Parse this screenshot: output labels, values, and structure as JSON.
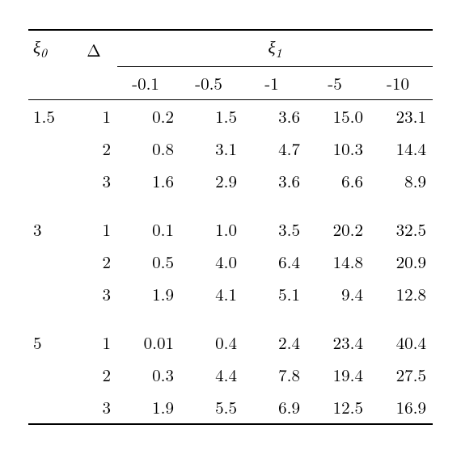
{
  "headers": {
    "xi0": "ξ",
    "xi0_sub": "0",
    "delta": "Δ",
    "xi1": "ξ",
    "xi1_sub": "1",
    "xi1_cols": [
      "-0.1",
      "-0.5",
      "-1",
      "-5",
      "-10"
    ]
  },
  "chart_data": {
    "type": "table",
    "title": "",
    "row_index": [
      "ξ0",
      "Δ"
    ],
    "col_index": "ξ1",
    "xi1_values": [
      -0.1,
      -0.5,
      -1,
      -5,
      -10
    ],
    "groups": [
      {
        "xi0": "1.5",
        "rows": [
          {
            "delta": "1",
            "values": [
              "0.2",
              "1.5",
              "3.6",
              "15.0",
              "23.1"
            ]
          },
          {
            "delta": "2",
            "values": [
              "0.8",
              "3.1",
              "4.7",
              "10.3",
              "14.4"
            ]
          },
          {
            "delta": "3",
            "values": [
              "1.6",
              "2.9",
              "3.6",
              "6.6",
              "8.9"
            ]
          }
        ]
      },
      {
        "xi0": "3",
        "rows": [
          {
            "delta": "1",
            "values": [
              "0.1",
              "1.0",
              "3.5",
              "20.2",
              "32.5"
            ]
          },
          {
            "delta": "2",
            "values": [
              "0.5",
              "4.0",
              "6.4",
              "14.8",
              "20.9"
            ]
          },
          {
            "delta": "3",
            "values": [
              "1.9",
              "4.1",
              "5.1",
              "9.4",
              "12.8"
            ]
          }
        ]
      },
      {
        "xi0": "5",
        "rows": [
          {
            "delta": "1",
            "values": [
              "0.01",
              "0.4",
              "2.4",
              "23.4",
              "40.4"
            ]
          },
          {
            "delta": "2",
            "values": [
              "0.3",
              "4.4",
              "7.8",
              "19.4",
              "27.5"
            ]
          },
          {
            "delta": "3",
            "values": [
              "1.9",
              "5.5",
              "6.9",
              "12.5",
              "16.9"
            ]
          }
        ]
      }
    ]
  }
}
